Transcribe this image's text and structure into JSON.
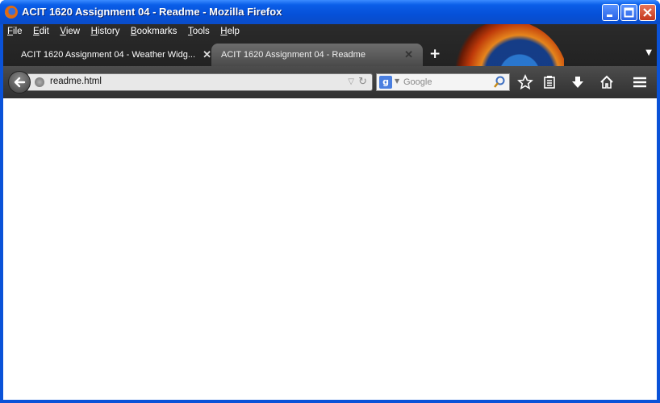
{
  "window": {
    "title": "ACIT 1620 Assignment 04 - Readme - Mozilla Firefox"
  },
  "menubar": {
    "items": [
      "File",
      "Edit",
      "View",
      "History",
      "Bookmarks",
      "Tools",
      "Help"
    ]
  },
  "tabs": [
    {
      "label": "ACIT 1620 Assignment 04 - Weather Widg...",
      "active": false
    },
    {
      "label": "ACIT 1620 Assignment 04 - Readme",
      "active": true
    }
  ],
  "navbar": {
    "url": "readme.html",
    "search_placeholder": "Google",
    "search_engine_icon": "google-icon"
  },
  "colors": {
    "titlebar": "#0a5ee8",
    "chrome": "#2b2b2b",
    "page": "#ffffff"
  }
}
